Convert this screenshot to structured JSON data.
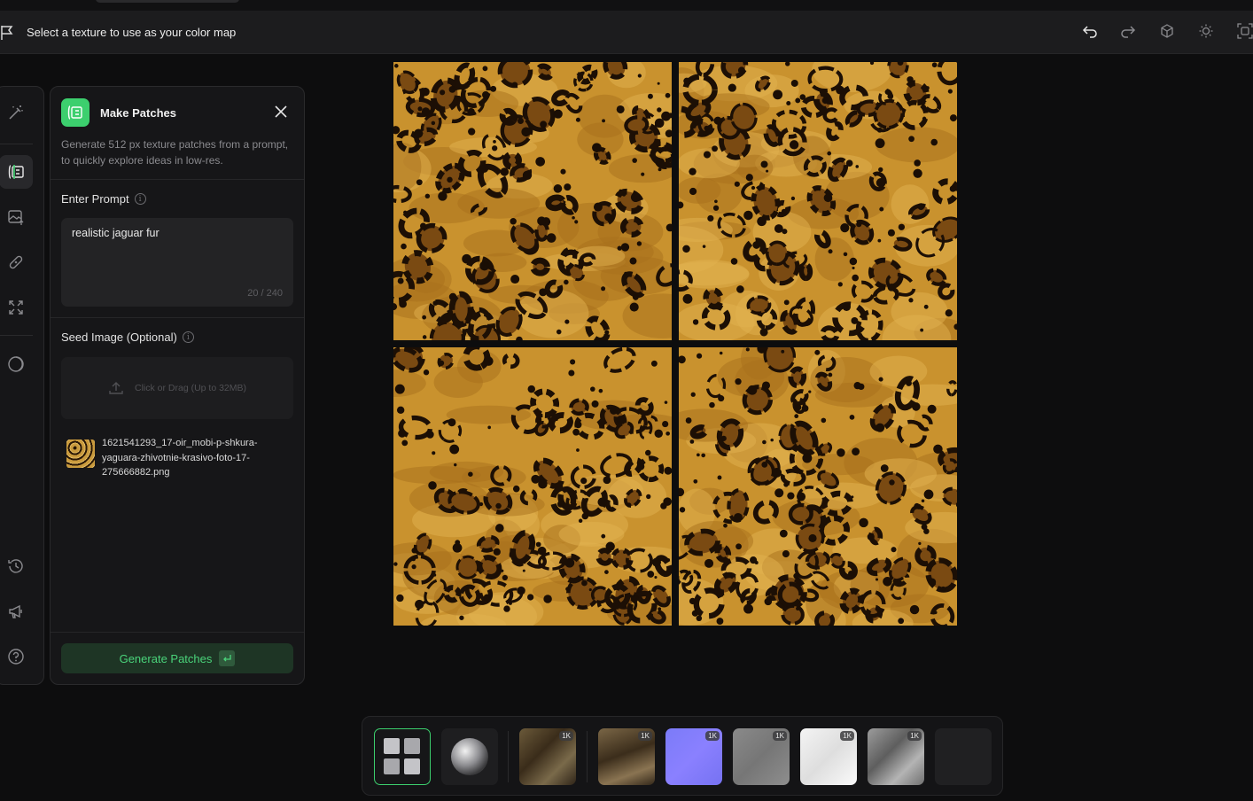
{
  "toolbar": {
    "message": "Select a texture to use as your color map",
    "icons": [
      "undo-icon",
      "redo-icon",
      "cube-icon",
      "sun-icon",
      "focus-icon"
    ]
  },
  "rail": {
    "items": [
      "magic-wand-icon",
      "make-patches-icon",
      "image-upload-icon",
      "bandage-icon",
      "expand-icon",
      "circle-gauge-icon",
      "history-icon",
      "megaphone-icon",
      "help-icon"
    ],
    "active": "make-patches-icon"
  },
  "panel": {
    "title": "Make Patches",
    "description": "Generate 512 px texture patches from a prompt, to quickly explore ideas in low-res.",
    "prompt_label": "Enter Prompt",
    "prompt_value": "realistic jaguar fur",
    "prompt_count": "20 / 240",
    "seed_label": "Seed Image (Optional)",
    "dropzone_text": "Click or Drag (Up to 32MB)",
    "seed_file_name": "1621541293_17-oir_mobi-p-shkura-yaguara-zhivotnie-krasivo-foto-17-275666882.png",
    "generate_label": "Generate Patches",
    "accent_color": "#3ccf6e"
  },
  "canvas": {
    "patches": [
      "jaguar-fur-patch-1",
      "jaguar-fur-patch-2",
      "jaguar-fur-patch-3",
      "jaguar-fur-patch-4"
    ]
  },
  "tray": {
    "items": [
      {
        "name": "grid-view-icon",
        "badge": ""
      },
      {
        "name": "sphere-preview",
        "badge": ""
      },
      {
        "name": "map-color",
        "badge": "1K"
      },
      {
        "name": "map-color-2",
        "badge": "1K"
      },
      {
        "name": "map-normal",
        "badge": "1K"
      },
      {
        "name": "map-height",
        "badge": "1K"
      },
      {
        "name": "map-roughness",
        "badge": "1K"
      },
      {
        "name": "map-ao",
        "badge": "1K"
      },
      {
        "name": "map-empty",
        "badge": ""
      }
    ]
  }
}
